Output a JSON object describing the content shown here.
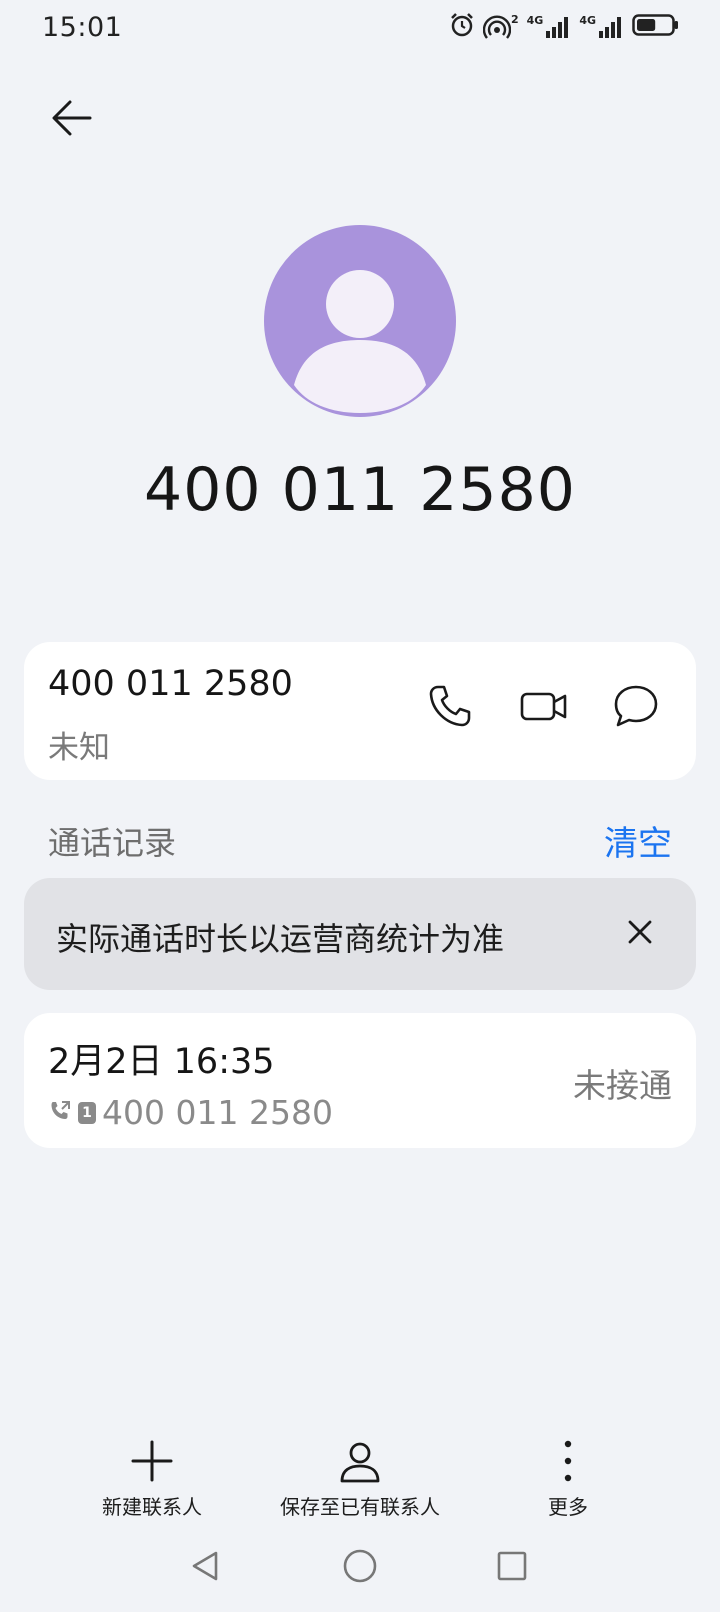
{
  "status_bar": {
    "time": "15:01",
    "sim1_network": "4G",
    "sim2_network": "4G",
    "hotspot_count": "2",
    "battery_level": 0.55
  },
  "header": {
    "phone_number": "400 011 2580"
  },
  "contact_card": {
    "number": "400 011 2580",
    "label": "未知"
  },
  "call_log": {
    "title": "通话记录",
    "clear_label": "清空",
    "notice": "实际通话时长以运营商统计为准",
    "entries": [
      {
        "datetime": "2月2日 16:35",
        "sim": "1",
        "number": "400 011 2580",
        "status": "未接通"
      }
    ]
  },
  "toolbar": {
    "new_contact": "新建联系人",
    "save_existing": "保存至已有联系人",
    "more": "更多"
  },
  "colors": {
    "accent": "#1b74f0",
    "avatar_bg": "#a993dc",
    "background": "#f1f3f7"
  }
}
